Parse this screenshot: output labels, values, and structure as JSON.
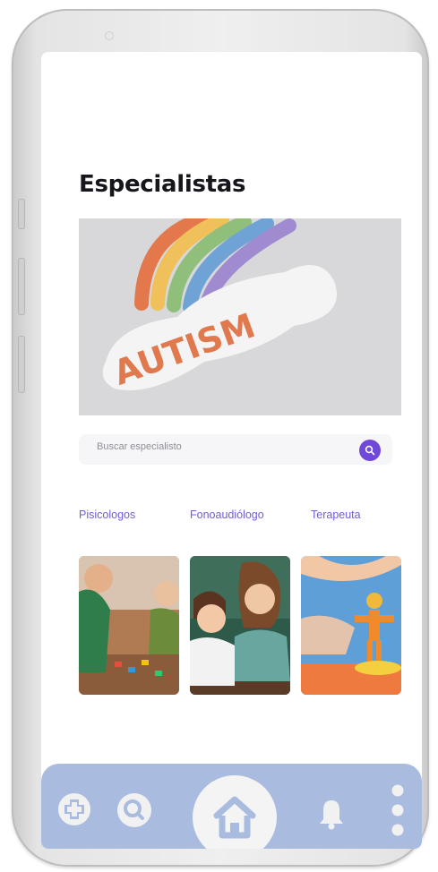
{
  "page": {
    "title": "Especialistas",
    "hero_image_text": "AUTISM"
  },
  "search": {
    "placeholder": "Buscar especialisto"
  },
  "categories": [
    {
      "label": "Pisicologos"
    },
    {
      "label": "Fonoaudiólogo"
    },
    {
      "label": "Terapeuta"
    }
  ],
  "specialist_photos": [
    {
      "name": "child-playing-with-toys"
    },
    {
      "name": "girls-learning-together"
    },
    {
      "name": "child-with-clay-figure"
    }
  ],
  "nav": {
    "items": [
      "add-icon",
      "search-icon",
      "home-icon",
      "bell-icon",
      "more-icon"
    ]
  },
  "colors": {
    "accent": "#7149d9",
    "category_text": "#6d5fd3",
    "navbar": "#a9bce0",
    "nav_icons": "#f1f1f1"
  }
}
